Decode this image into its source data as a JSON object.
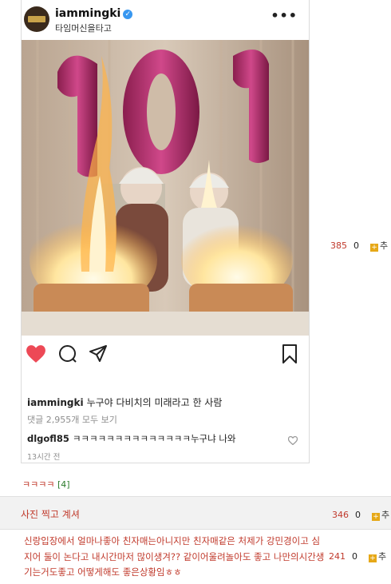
{
  "post": {
    "username": "iammingki",
    "subtitle": "타임머신을타고",
    "more": "•••",
    "photo_numbers": "101",
    "caption_user": "iammingki",
    "caption_text": "누구야 다비치의 미래라고 한 사람",
    "view_comments": "댓글 2,955개 모두 보기",
    "comment_user": "dlgofl85",
    "comment_text": "ㅋㅋㅋㅋㅋㅋㅋㅋㅋㅋㅋㅋㅋㅋ누구냐 나와",
    "time": "13시간 전",
    "colors": {
      "like": "#ed4956",
      "verified": "#3897f0"
    }
  },
  "side_rows": [
    {
      "views": "385",
      "count": "0",
      "recommend": "추"
    }
  ],
  "reply_tag": {
    "text": "ㅋㅋㅋㅋ",
    "count": "[4]"
  },
  "rows": [
    {
      "title": "사진 찍고 계셔",
      "views": "346",
      "count": "0",
      "recommend": "추"
    },
    {
      "title": "신랑입장에서 얼마나좋아 친자매는아니지만 친자매같은 처제가 강민경이고 심지어 둘이 논다고 내시간마저 많이생겨?? 같이어울려놀아도 좋고 나만의시간생기는거도좋고 어떻게해도 좋은상황임ㅎㅎ",
      "views": "241",
      "count": "0",
      "recommend": "추"
    }
  ]
}
